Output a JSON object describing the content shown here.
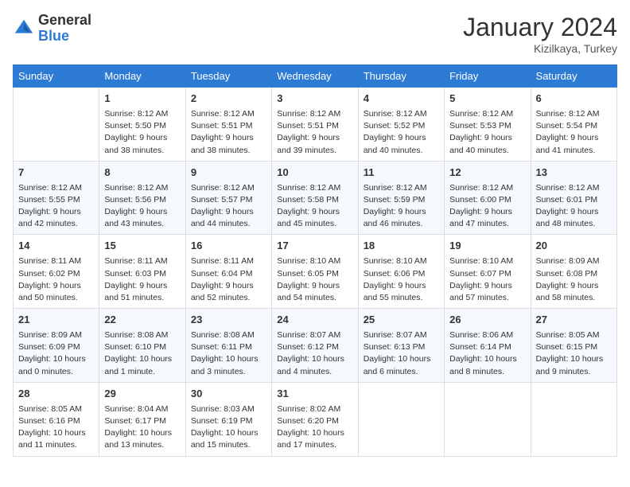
{
  "logo": {
    "general": "General",
    "blue": "Blue"
  },
  "header": {
    "month_year": "January 2024",
    "location": "Kizilkaya, Turkey"
  },
  "days_of_week": [
    "Sunday",
    "Monday",
    "Tuesday",
    "Wednesday",
    "Thursday",
    "Friday",
    "Saturday"
  ],
  "weeks": [
    [
      {
        "day": "",
        "info": ""
      },
      {
        "day": "1",
        "info": "Sunrise: 8:12 AM\nSunset: 5:50 PM\nDaylight: 9 hours\nand 38 minutes."
      },
      {
        "day": "2",
        "info": "Sunrise: 8:12 AM\nSunset: 5:51 PM\nDaylight: 9 hours\nand 38 minutes."
      },
      {
        "day": "3",
        "info": "Sunrise: 8:12 AM\nSunset: 5:51 PM\nDaylight: 9 hours\nand 39 minutes."
      },
      {
        "day": "4",
        "info": "Sunrise: 8:12 AM\nSunset: 5:52 PM\nDaylight: 9 hours\nand 40 minutes."
      },
      {
        "day": "5",
        "info": "Sunrise: 8:12 AM\nSunset: 5:53 PM\nDaylight: 9 hours\nand 40 minutes."
      },
      {
        "day": "6",
        "info": "Sunrise: 8:12 AM\nSunset: 5:54 PM\nDaylight: 9 hours\nand 41 minutes."
      }
    ],
    [
      {
        "day": "7",
        "info": "Sunrise: 8:12 AM\nSunset: 5:55 PM\nDaylight: 9 hours\nand 42 minutes."
      },
      {
        "day": "8",
        "info": "Sunrise: 8:12 AM\nSunset: 5:56 PM\nDaylight: 9 hours\nand 43 minutes."
      },
      {
        "day": "9",
        "info": "Sunrise: 8:12 AM\nSunset: 5:57 PM\nDaylight: 9 hours\nand 44 minutes."
      },
      {
        "day": "10",
        "info": "Sunrise: 8:12 AM\nSunset: 5:58 PM\nDaylight: 9 hours\nand 45 minutes."
      },
      {
        "day": "11",
        "info": "Sunrise: 8:12 AM\nSunset: 5:59 PM\nDaylight: 9 hours\nand 46 minutes."
      },
      {
        "day": "12",
        "info": "Sunrise: 8:12 AM\nSunset: 6:00 PM\nDaylight: 9 hours\nand 47 minutes."
      },
      {
        "day": "13",
        "info": "Sunrise: 8:12 AM\nSunset: 6:01 PM\nDaylight: 9 hours\nand 48 minutes."
      }
    ],
    [
      {
        "day": "14",
        "info": "Sunrise: 8:11 AM\nSunset: 6:02 PM\nDaylight: 9 hours\nand 50 minutes."
      },
      {
        "day": "15",
        "info": "Sunrise: 8:11 AM\nSunset: 6:03 PM\nDaylight: 9 hours\nand 51 minutes."
      },
      {
        "day": "16",
        "info": "Sunrise: 8:11 AM\nSunset: 6:04 PM\nDaylight: 9 hours\nand 52 minutes."
      },
      {
        "day": "17",
        "info": "Sunrise: 8:10 AM\nSunset: 6:05 PM\nDaylight: 9 hours\nand 54 minutes."
      },
      {
        "day": "18",
        "info": "Sunrise: 8:10 AM\nSunset: 6:06 PM\nDaylight: 9 hours\nand 55 minutes."
      },
      {
        "day": "19",
        "info": "Sunrise: 8:10 AM\nSunset: 6:07 PM\nDaylight: 9 hours\nand 57 minutes."
      },
      {
        "day": "20",
        "info": "Sunrise: 8:09 AM\nSunset: 6:08 PM\nDaylight: 9 hours\nand 58 minutes."
      }
    ],
    [
      {
        "day": "21",
        "info": "Sunrise: 8:09 AM\nSunset: 6:09 PM\nDaylight: 10 hours\nand 0 minutes."
      },
      {
        "day": "22",
        "info": "Sunrise: 8:08 AM\nSunset: 6:10 PM\nDaylight: 10 hours\nand 1 minute."
      },
      {
        "day": "23",
        "info": "Sunrise: 8:08 AM\nSunset: 6:11 PM\nDaylight: 10 hours\nand 3 minutes."
      },
      {
        "day": "24",
        "info": "Sunrise: 8:07 AM\nSunset: 6:12 PM\nDaylight: 10 hours\nand 4 minutes."
      },
      {
        "day": "25",
        "info": "Sunrise: 8:07 AM\nSunset: 6:13 PM\nDaylight: 10 hours\nand 6 minutes."
      },
      {
        "day": "26",
        "info": "Sunrise: 8:06 AM\nSunset: 6:14 PM\nDaylight: 10 hours\nand 8 minutes."
      },
      {
        "day": "27",
        "info": "Sunrise: 8:05 AM\nSunset: 6:15 PM\nDaylight: 10 hours\nand 9 minutes."
      }
    ],
    [
      {
        "day": "28",
        "info": "Sunrise: 8:05 AM\nSunset: 6:16 PM\nDaylight: 10 hours\nand 11 minutes."
      },
      {
        "day": "29",
        "info": "Sunrise: 8:04 AM\nSunset: 6:17 PM\nDaylight: 10 hours\nand 13 minutes."
      },
      {
        "day": "30",
        "info": "Sunrise: 8:03 AM\nSunset: 6:19 PM\nDaylight: 10 hours\nand 15 minutes."
      },
      {
        "day": "31",
        "info": "Sunrise: 8:02 AM\nSunset: 6:20 PM\nDaylight: 10 hours\nand 17 minutes."
      },
      {
        "day": "",
        "info": ""
      },
      {
        "day": "",
        "info": ""
      },
      {
        "day": "",
        "info": ""
      }
    ]
  ]
}
